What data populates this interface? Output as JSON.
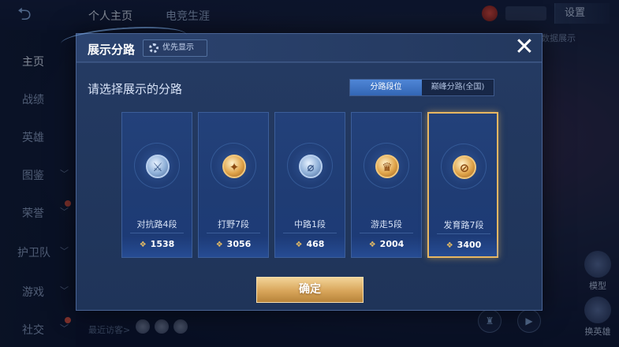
{
  "topbar": {
    "tabs": [
      {
        "label": "个人主页",
        "active": true
      },
      {
        "label": "电竞生涯",
        "active": false
      }
    ],
    "settings_label": "设置"
  },
  "sidebar": {
    "items": [
      {
        "label": "主页",
        "has_chevron": false,
        "active": true
      },
      {
        "label": "战绩",
        "has_chevron": false,
        "active": false
      },
      {
        "label": "英雄",
        "has_chevron": false,
        "active": false
      },
      {
        "label": "图鉴",
        "has_chevron": true,
        "active": false
      },
      {
        "label": "荣誉",
        "has_chevron": true,
        "active": false
      },
      {
        "label": "护卫队",
        "has_chevron": true,
        "active": false
      },
      {
        "label": "游戏",
        "has_chevron": true,
        "active": false
      },
      {
        "label": "社交",
        "has_chevron": true,
        "active": false
      }
    ]
  },
  "background": {
    "recent_visitors_label": "最近访客>",
    "right_text": "主和数据展示",
    "model_label": "模型",
    "change_hero_label": "换英雄"
  },
  "modal": {
    "title": "展示分路",
    "priority_label": "优先显示",
    "close_symbol": "✕",
    "prompt": "请选择展示的分路",
    "segments": [
      {
        "label": "分路段位",
        "active": true
      },
      {
        "label": "巅峰分路(全国)",
        "active": false
      }
    ],
    "cards": [
      {
        "name": "对抗路4段",
        "score": "1538",
        "emblem": "silver",
        "glyph": "⚔",
        "selected": false
      },
      {
        "name": "打野7段",
        "score": "3056",
        "emblem": "gold",
        "glyph": "✦",
        "selected": false
      },
      {
        "name": "中路1段",
        "score": "468",
        "emblem": "silver",
        "glyph": "⌀",
        "selected": false
      },
      {
        "name": "游走5段",
        "score": "2004",
        "emblem": "gold",
        "glyph": "♛",
        "selected": false
      },
      {
        "name": "发育路7段",
        "score": "3400",
        "emblem": "gold",
        "glyph": "⊘",
        "selected": true
      }
    ],
    "score_icon": "❖",
    "confirm_label": "确定"
  },
  "colors": {
    "accent_blue": "#3f78c8",
    "gold": "#e8b761",
    "panel": "#22355a"
  }
}
